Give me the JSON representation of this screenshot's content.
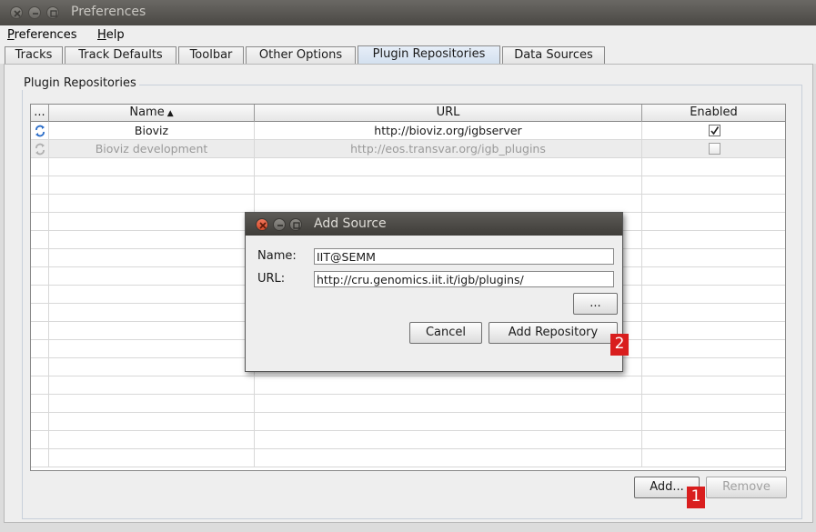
{
  "window": {
    "title": "Preferences"
  },
  "menubar": {
    "items": [
      {
        "label": "Preferences",
        "mnemonic": "P",
        "rest": "references"
      },
      {
        "label": "Help",
        "mnemonic": "H",
        "rest": "elp"
      }
    ]
  },
  "tabs": [
    {
      "label": "Tracks",
      "active": false
    },
    {
      "label": "Track Defaults",
      "active": false
    },
    {
      "label": "Toolbar",
      "active": false
    },
    {
      "label": "Other Options",
      "active": false
    },
    {
      "label": "Plugin Repositories",
      "active": true
    },
    {
      "label": "Data Sources",
      "active": false
    }
  ],
  "panel": {
    "group_title": "Plugin Repositories"
  },
  "table": {
    "columns": [
      {
        "label": "...",
        "key": "refresh"
      },
      {
        "label": "Name",
        "sorted": "ascending"
      },
      {
        "label": "URL"
      },
      {
        "label": "Enabled"
      }
    ],
    "rows": [
      {
        "name": "Bioviz",
        "url": "http://bioviz.org/igbserver",
        "enabled": true,
        "icon": "refresh-icon"
      },
      {
        "name": "Bioviz development",
        "url": "http://eos.transvar.org/igb_plugins",
        "enabled": false,
        "icon": "refresh-icon"
      }
    ]
  },
  "buttons": {
    "add": "Add...",
    "remove": "Remove",
    "add_badge": "1"
  },
  "dialog": {
    "title": "Add Source",
    "name_label": "Name:",
    "name_value": "IIT@SEMM",
    "url_label": "URL:",
    "url_value": "http://cru.genomics.iit.it/igb/plugins/",
    "browse_label": "...",
    "cancel_label": "Cancel",
    "add_repository_label": "Add Repository",
    "badge": "2"
  },
  "colors": {
    "accent_tab": "#d3e0ef",
    "badge": "#d91e1e",
    "titlebar": "#4a4844"
  }
}
